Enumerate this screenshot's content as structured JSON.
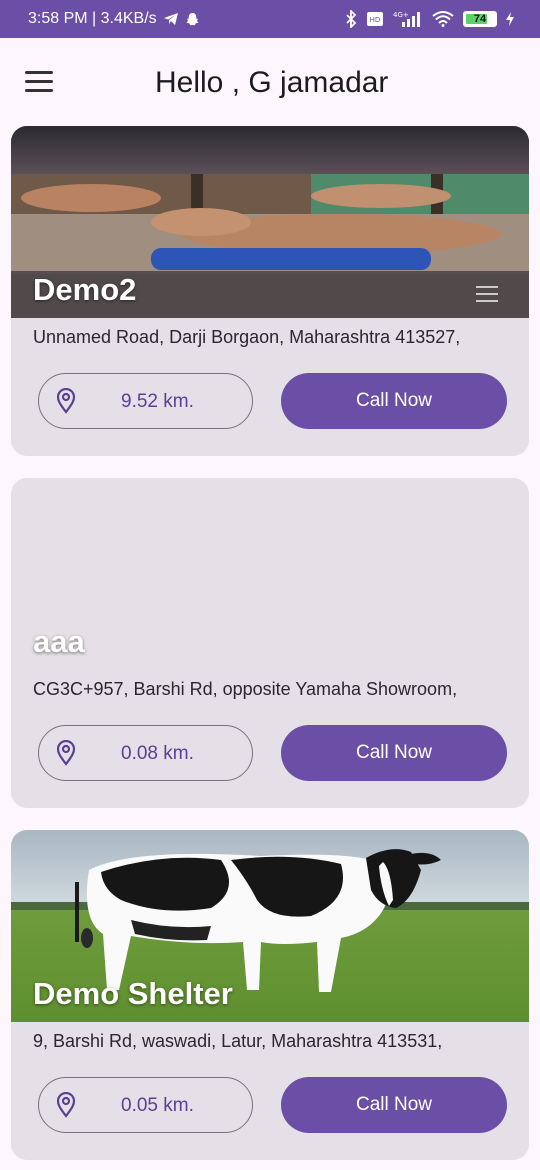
{
  "status_bar": {
    "time_text": "3:58 PM | 3.4KB/s",
    "battery": "74",
    "network": "4G+"
  },
  "app_bar": {
    "title": "Hello , G jamadar"
  },
  "colors": {
    "accent": "#6b4fa6",
    "card_bg": "#e5e0e7",
    "page_bg": "#fdf7fd"
  },
  "shelters": [
    {
      "name": "Demo2",
      "address": "Unnamed Road, Darji Borgaon, Maharashtra 413527,",
      "distance": "9.52 km.",
      "call_label": "Call Now",
      "image": "cows-in-barn-photo"
    },
    {
      "name": "aaa",
      "address": "CG3C+957, Barshi Rd, opposite Yamaha Showroom,",
      "distance": "0.08 km.",
      "call_label": "Call Now",
      "image": "none"
    },
    {
      "name": "Demo Shelter",
      "address": "9, Barshi Rd, waswadi, Latur, Maharashtra 413531,",
      "distance": "0.05 km.",
      "call_label": "Call Now",
      "image": "holstein-cow-photo"
    }
  ]
}
